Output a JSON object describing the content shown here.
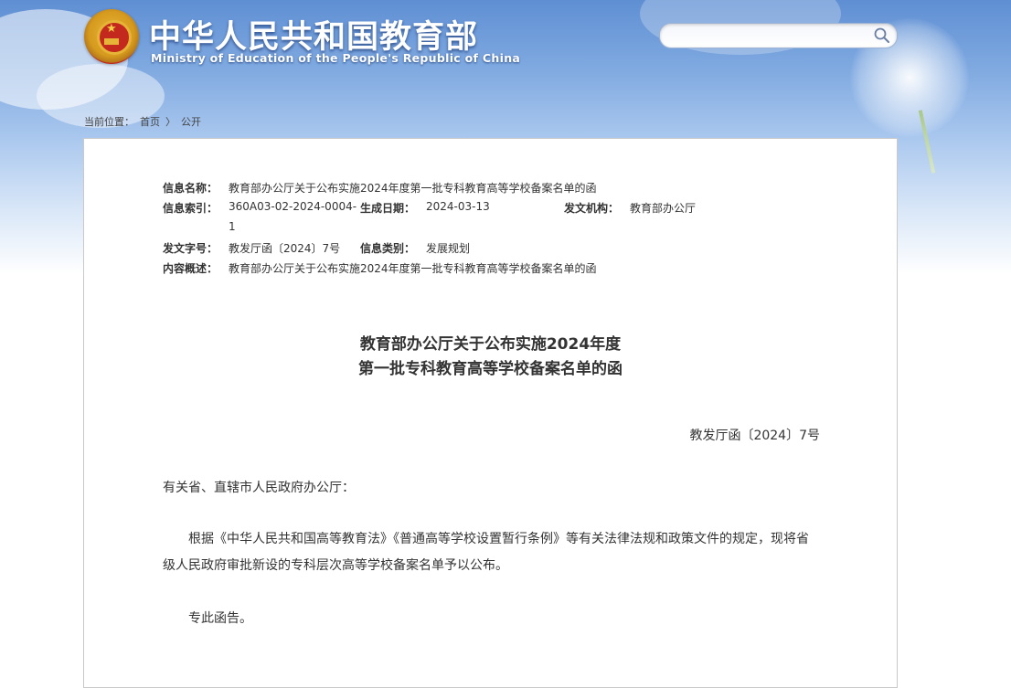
{
  "header": {
    "title": "中华人民共和国教育部",
    "subtitle": "Ministry of Education of the People's Republic of China",
    "search": {
      "placeholder": "",
      "icon": "search-icon"
    }
  },
  "breadcrumb": {
    "prefix": "当前位置：",
    "items": [
      "首页",
      "公开"
    ],
    "separator": "〉"
  },
  "metadata": {
    "name_label": "信息名称：",
    "name_value": "教育部办公厅关于公布实施2024年度第一批专科教育高等学校备案名单的函",
    "index_label": "信息索引：",
    "index_value_line1": "360A03-02-2024-0004-",
    "index_value_line2": "1",
    "date_label": "生成日期：",
    "date_value": "2024-03-13",
    "org_label": "发文机构：",
    "org_value": "教育部办公厅",
    "docno_label": "发文字号：",
    "docno_value": "教发厅函〔2024〕7号",
    "category_label": "信息类别：",
    "category_value": "发展规划",
    "summary_label": "内容概述：",
    "summary_value": "教育部办公厅关于公布实施2024年度第一批专科教育高等学校备案名单的函"
  },
  "document": {
    "title_line1": "教育部办公厅关于公布实施2024年度",
    "title_line2": "第一批专科教育高等学校备案名单的函",
    "number": "教发厅函〔2024〕7号",
    "greeting": "有关省、直辖市人民政府办公厅：",
    "paragraph1": "根据《中华人民共和国高等教育法》《普通高等学校设置暂行条例》等有关法律法规和政策文件的规定，现将省级人民政府审批新设的专科层次高等学校备案名单予以公布。",
    "paragraph2": "专此函告。"
  },
  "colors": {
    "sky_top": "#5f8fd3",
    "title_text": "#ffffff",
    "body_text": "#333333",
    "panel_border": "#c9c9c9"
  }
}
